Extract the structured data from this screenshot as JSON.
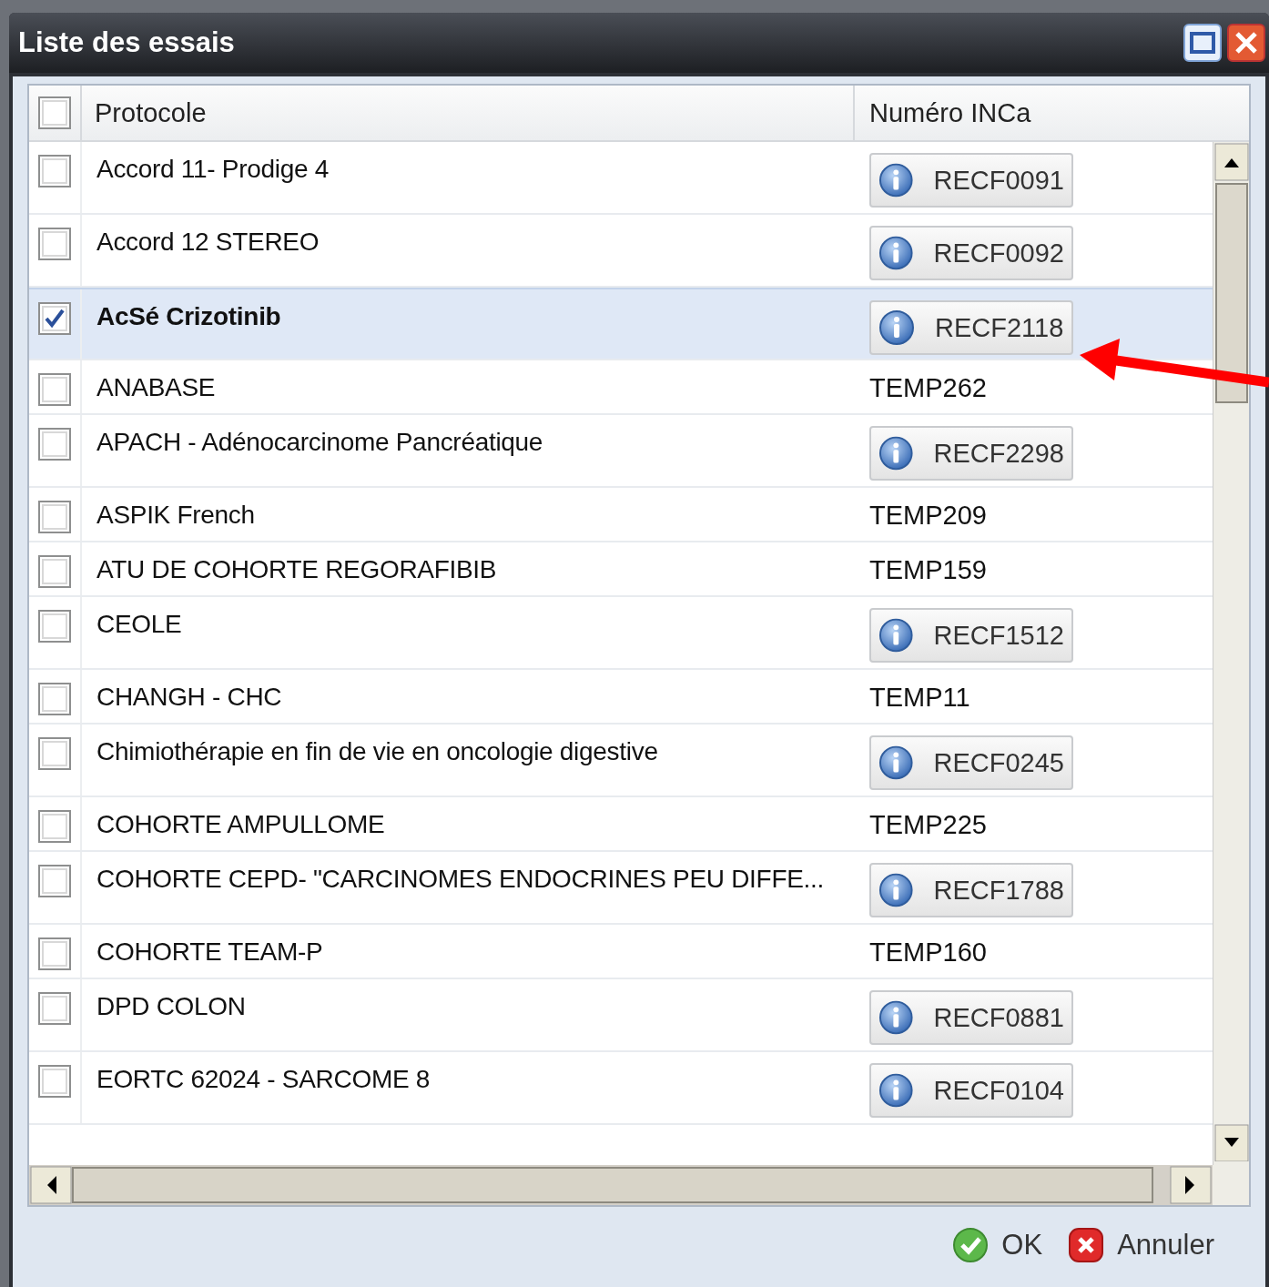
{
  "window": {
    "title": "Liste des essais"
  },
  "table": {
    "select_all": {
      "checked": false
    },
    "columns": [
      "Protocole",
      "Numéro INCa"
    ],
    "rows": [
      {
        "protocole": "Accord 11- Prodige 4",
        "numero": "RECF0091",
        "kind": "button",
        "selected": false
      },
      {
        "protocole": "Accord 12 STEREO",
        "numero": "RECF0092",
        "kind": "button",
        "selected": false
      },
      {
        "protocole": "AcSé Crizotinib",
        "numero": "RECF2118",
        "kind": "button",
        "selected": true
      },
      {
        "protocole": "ANABASE",
        "numero": "TEMP262",
        "kind": "text",
        "selected": false
      },
      {
        "protocole": "APACH - Adénocarcinome Pancréatique",
        "numero": "RECF2298",
        "kind": "button",
        "selected": false
      },
      {
        "protocole": "ASPIK French",
        "numero": "TEMP209",
        "kind": "text",
        "selected": false
      },
      {
        "protocole": "ATU DE COHORTE REGORAFIBIB",
        "numero": "TEMP159",
        "kind": "text",
        "selected": false
      },
      {
        "protocole": "CEOLE",
        "numero": "RECF1512",
        "kind": "button",
        "selected": false
      },
      {
        "protocole": "CHANGH - CHC",
        "numero": "TEMP11",
        "kind": "text",
        "selected": false
      },
      {
        "protocole": "Chimiothérapie en fin de vie en oncologie digestive",
        "numero": "RECF0245",
        "kind": "button",
        "selected": false
      },
      {
        "protocole": "COHORTE AMPULLOME",
        "numero": "TEMP225",
        "kind": "text",
        "selected": false
      },
      {
        "protocole": "COHORTE CEPD- \"CARCINOMES ENDOCRINES PEU DIFFE...",
        "numero": "RECF1788",
        "kind": "button",
        "selected": false
      },
      {
        "protocole": "COHORTE TEAM-P",
        "numero": "TEMP160",
        "kind": "text",
        "selected": false
      },
      {
        "protocole": "DPD COLON",
        "numero": "RECF0881",
        "kind": "button",
        "selected": false
      },
      {
        "protocole": "EORTC 62024 - SARCOME 8",
        "numero": "RECF0104",
        "kind": "button",
        "selected": false
      }
    ]
  },
  "buttons": [
    "OK",
    "Annuler"
  ]
}
